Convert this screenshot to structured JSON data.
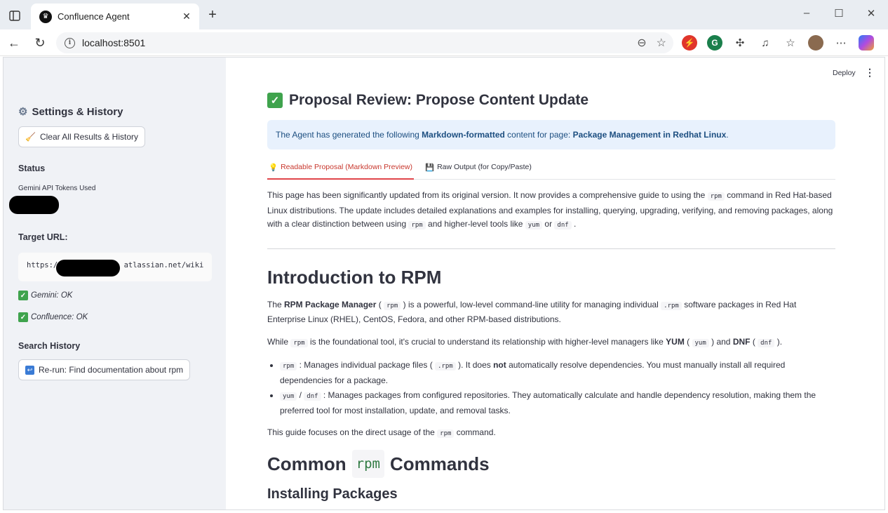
{
  "browser": {
    "tab_title": "Confluence Agent",
    "url": "localhost:8501"
  },
  "sidebar": {
    "heading": "Settings & History",
    "clear_button": "Clear All Results & History",
    "status_label": "Status",
    "tokens_label": "Gemini API Tokens Used",
    "target_label": "Target URL:",
    "target_url_prefix": "https://",
    "target_url_suffix": "atlassian.net/wiki",
    "gemini_status": "Gemini: OK",
    "confluence_status": "Confluence: OK",
    "history_label": "Search History",
    "history_items": [
      "Re-run: Find documentation about rpm"
    ]
  },
  "header": {
    "deploy": "Deploy"
  },
  "main": {
    "title": "Proposal Review: Propose Content Update",
    "banner": {
      "pre": "The Agent has generated the following ",
      "bold1": "Markdown-formatted",
      "mid": " content for page: ",
      "bold2": "Package Management in Redhat Linux",
      "post": "."
    },
    "tabs": [
      "Readable Proposal (Markdown Preview)",
      "Raw Output (for Copy/Paste)"
    ],
    "intro": {
      "t1": "This page has been significantly updated from its original version. It now provides a comprehensive guide to using the ",
      "c1": "rpm",
      "t2": " command in Red Hat-based Linux distributions. The update includes detailed explanations and examples for installing, querying, upgrading, verifying, and removing packages, along with a clear distinction between using ",
      "c2": "rpm",
      "t3": " and higher-level tools like ",
      "c3": "yum",
      "t4": " or ",
      "c4": "dnf",
      "t5": " ."
    },
    "h_intro": "Introduction to RPM",
    "p1": {
      "t1": "The ",
      "b1": "RPM Package Manager",
      "t2": " ( ",
      "c1": "rpm",
      "t3": " ) is a powerful, low-level command-line utility for managing individual ",
      "c2": ".rpm",
      "t4": " software packages in Red Hat Enterprise Linux (RHEL), CentOS, Fedora, and other RPM-based distributions."
    },
    "p2": {
      "t1": "While ",
      "c1": "rpm",
      "t2": " is the foundational tool, it's crucial to understand its relationship with higher-level managers like ",
      "b1": "YUM",
      "t3": " ( ",
      "c2": "yum",
      "t4": " ) and ",
      "b2": "DNF",
      "t5": " ( ",
      "c3": "dnf",
      "t6": " )."
    },
    "li1": {
      "c1": "rpm",
      "t1": " : Manages individual package files ( ",
      "c2": ".rpm",
      "t2": " ). It does ",
      "b1": "not",
      "t3": " automatically resolve dependencies. You must manually install all required dependencies for a package."
    },
    "li2": {
      "c1": "yum",
      "t1": " / ",
      "c2": "dnf",
      "t2": " : Manages packages from configured repositories. They automatically calculate and handle dependency resolution, making them the preferred tool for most installation, update, and removal tasks."
    },
    "p3": {
      "t1": "This guide focuses on the direct usage of the ",
      "c1": "rpm",
      "t2": " command."
    },
    "h_common_pre": "Common",
    "h_common_code": "rpm",
    "h_common_post": "Commands",
    "h_installing": "Installing Packages"
  },
  "colors": {
    "sidebar_bg": "#f0f2f6",
    "accent_red": "#e0454a",
    "banner_bg": "#e8f1fd",
    "check_green": "#3fa34d"
  },
  "icons": [
    "sidebar-toggle-icon",
    "crown-icon",
    "close-icon",
    "plus-icon",
    "back-icon",
    "reload-icon",
    "info-icon",
    "zoom-icon",
    "star-icon",
    "gear-icon",
    "broom-icon",
    "check-icon",
    "rerun-icon",
    "kebab-icon",
    "bulb-icon",
    "floppy-icon"
  ]
}
